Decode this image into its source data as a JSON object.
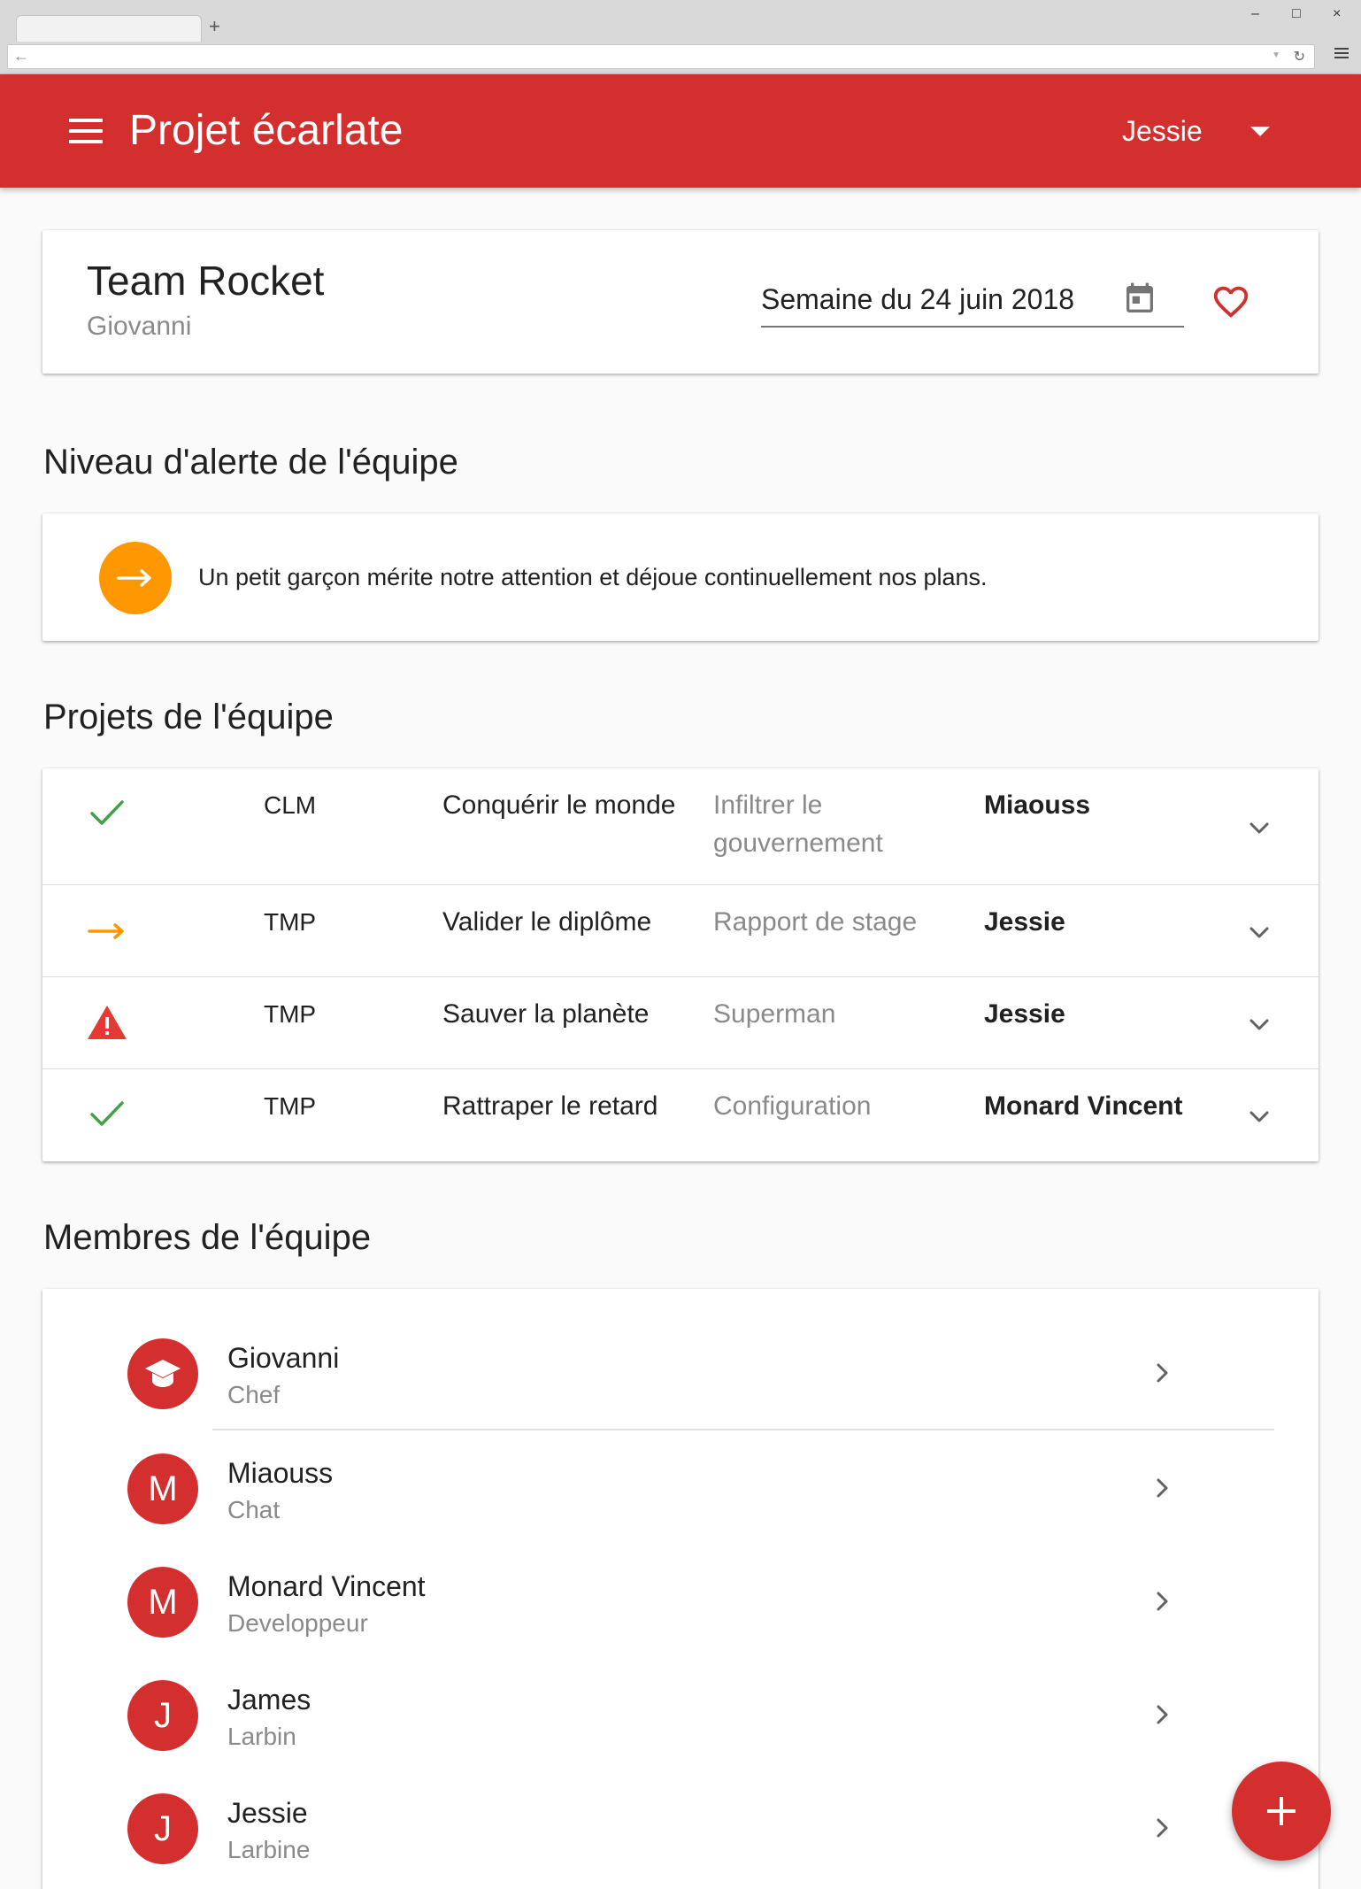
{
  "browser": {
    "new_tab_glyph": "+",
    "minimize_glyph": "–",
    "maximize_glyph": "□",
    "close_glyph": "×",
    "back_glyph": "←",
    "dropdown_glyph": "▼",
    "reload_glyph": "↻"
  },
  "appbar": {
    "title": "Projet écarlate",
    "user": "Jessie",
    "color": "#d32f2f"
  },
  "team": {
    "name": "Team Rocket",
    "owner": "Giovanni",
    "week": "Semaine du 24 juin 2018"
  },
  "alert": {
    "title": "Niveau d'alerte de l'équipe",
    "message": "Un petit garçon mérite notre attention et déjoue continuellement nos plans.",
    "level_icon": "arrow-right-icon",
    "color": "#ff9800"
  },
  "projects": {
    "title": "Projets de l'équipe",
    "rows": [
      {
        "status": "check-icon",
        "code": "CLM",
        "name": "Conquérir le monde",
        "sub": "Infiltrer le gouvernement",
        "owner": "Miaouss"
      },
      {
        "status": "arrow-right-icon",
        "code": "TMP",
        "name": "Valider le diplôme",
        "sub": "Rapport de stage",
        "owner": "Jessie"
      },
      {
        "status": "warning-icon",
        "code": "TMP",
        "name": "Sauver la planète",
        "sub": "Superman",
        "owner": "Jessie"
      },
      {
        "status": "check-icon",
        "code": "TMP",
        "name": "Rattraper le retard",
        "sub": "Configuration",
        "owner": "Monard Vincent"
      }
    ]
  },
  "members": {
    "title": "Membres de l'équipe",
    "items": [
      {
        "avatar": "",
        "avatar_icon": "graduation-cap-icon",
        "name": "Giovanni",
        "role": "Chef"
      },
      {
        "avatar": "M",
        "name": "Miaouss",
        "role": "Chat"
      },
      {
        "avatar": "M",
        "name": "Monard Vincent",
        "role": "Developpeur"
      },
      {
        "avatar": "J",
        "name": "James",
        "role": "Larbin"
      },
      {
        "avatar": "J",
        "name": "Jessie",
        "role": "Larbine"
      }
    ]
  },
  "fab": {
    "icon": "plus-icon"
  }
}
